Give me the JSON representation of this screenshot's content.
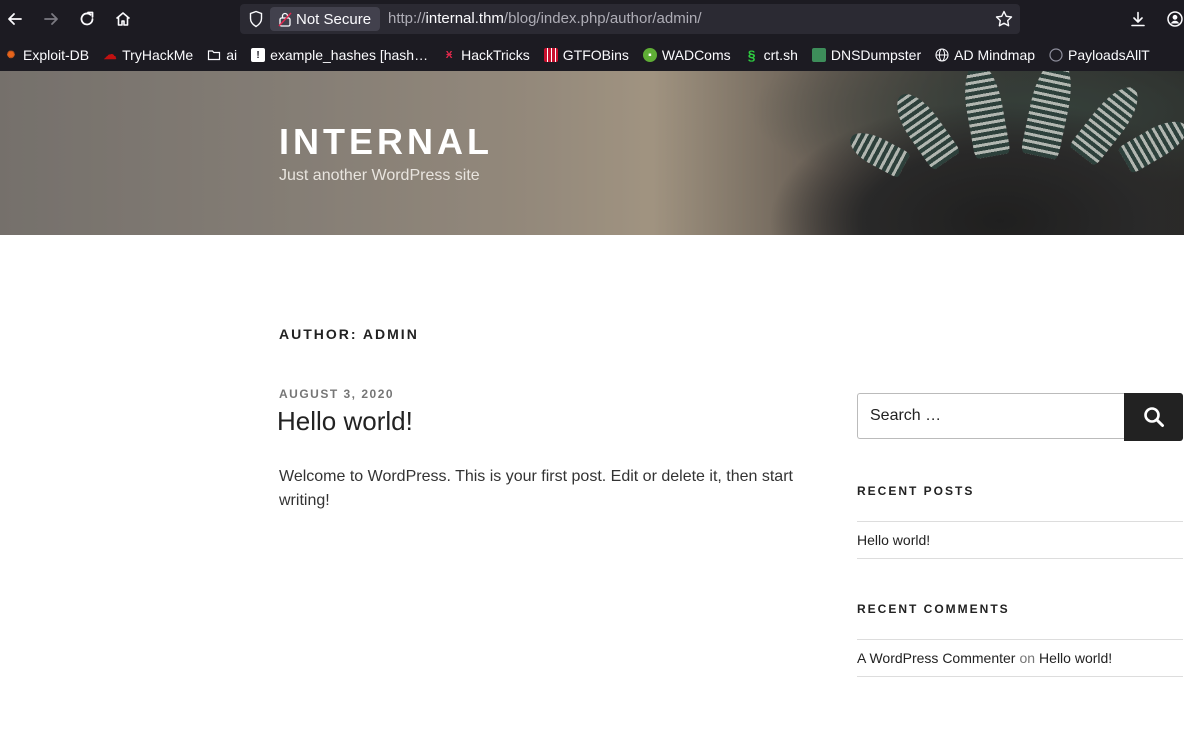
{
  "browser": {
    "security_label": "Not Secure",
    "url_scheme": "http://",
    "url_domain": "internal.thm",
    "url_path": "/blog/index.php/author/admin/"
  },
  "bookmarks": [
    {
      "label": "Exploit-DB",
      "icon": "exploit-db-icon",
      "color": "#e8641b"
    },
    {
      "label": "TryHackMe",
      "icon": "tryhackme-icon",
      "color": "#c11111"
    },
    {
      "label": "ai",
      "icon": "folder-icon",
      "color": "#fbfbfe"
    },
    {
      "label": "example_hashes [hash…",
      "icon": "hashcat-icon",
      "color": "#ffffff"
    },
    {
      "label": "HackTricks",
      "icon": "hacktricks-icon",
      "color": "#e0284b"
    },
    {
      "label": "GTFOBins",
      "icon": "gtfobins-icon",
      "color": "#c8102e"
    },
    {
      "label": "WADComs",
      "icon": "wadcoms-icon",
      "color": "#5fae36"
    },
    {
      "label": "crt.sh",
      "icon": "crtsh-icon",
      "color": "#2ecc40"
    },
    {
      "label": "DNSDumpster",
      "icon": "dnsdumpster-icon",
      "color": "#3d8d5a"
    },
    {
      "label": "AD Mindmap",
      "icon": "globe-icon",
      "color": "#fbfbfe"
    },
    {
      "label": "PayloadsAllT",
      "icon": "github-icon",
      "color": "#fbfbfe"
    }
  ],
  "site": {
    "title": "INTERNAL",
    "tagline": "Just another WordPress site"
  },
  "main": {
    "page_title": "AUTHOR: ADMIN",
    "post": {
      "date": "AUGUST 3, 2020",
      "title": "Hello world!",
      "excerpt": "Welcome to WordPress. This is your first post. Edit or delete it, then start writing!"
    }
  },
  "sidebar": {
    "search_placeholder": "Search …",
    "search_button": "Search",
    "recent_posts_title": "RECENT POSTS",
    "recent_posts": [
      "Hello world!"
    ],
    "recent_comments_title": "RECENT COMMENTS",
    "recent_comment": {
      "author": "A WordPress Commenter",
      "on": "on",
      "post": "Hello world!"
    }
  }
}
